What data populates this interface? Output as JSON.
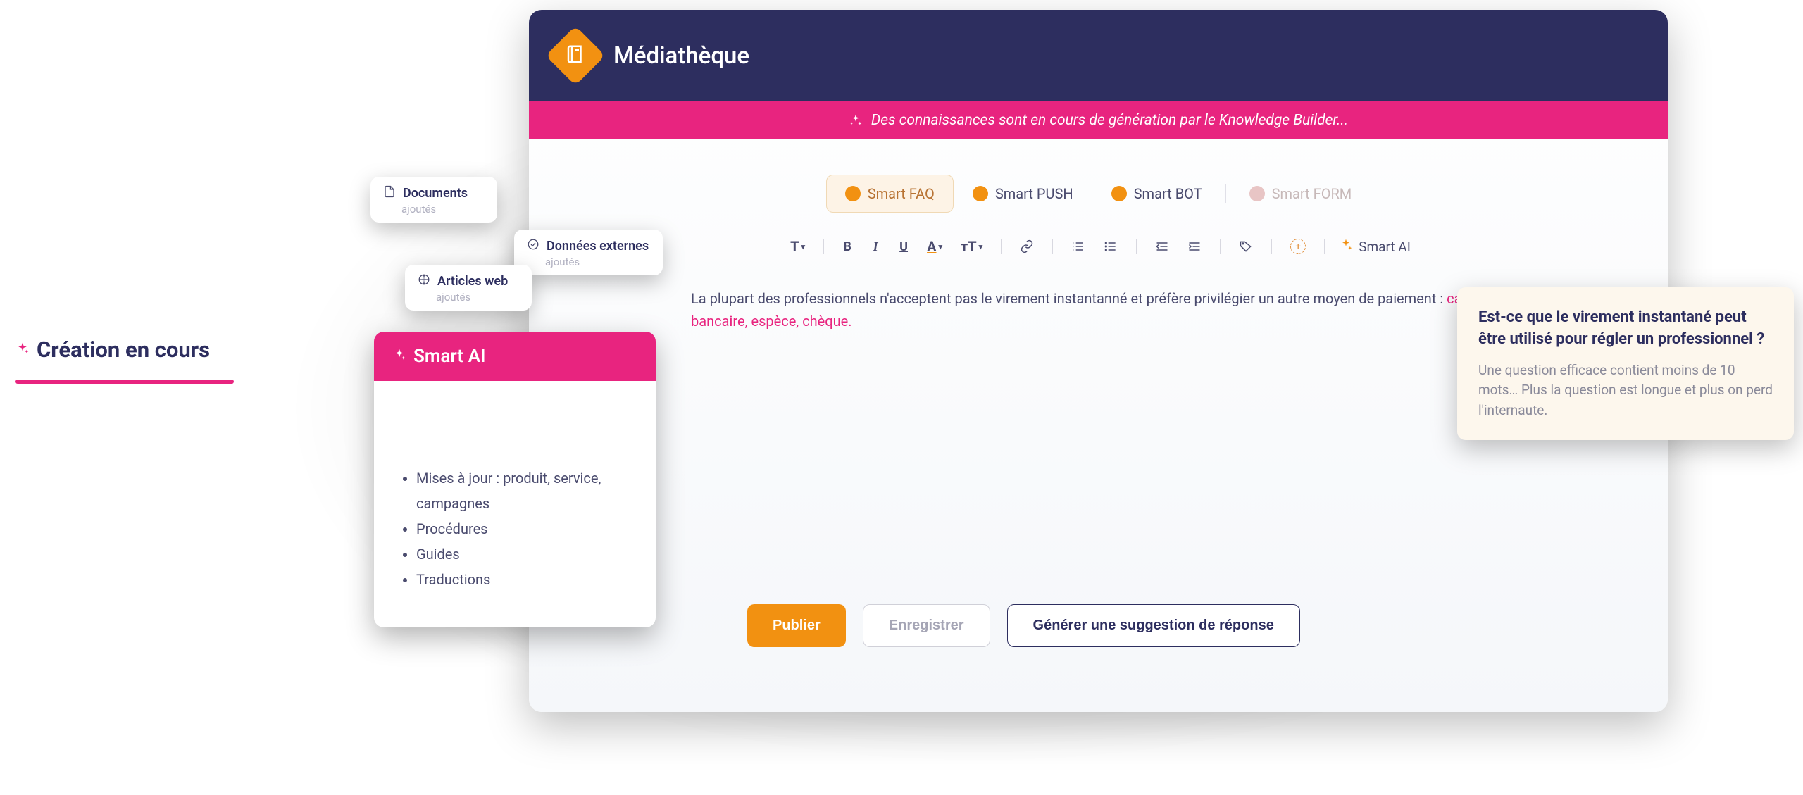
{
  "header": {
    "title": "Médiathèque"
  },
  "alert": {
    "text": "Des connaissances sont en cours de génération par le Knowledge Builder..."
  },
  "tabs": {
    "items": [
      {
        "label": "Smart FAQ",
        "active": true
      },
      {
        "label": "Smart PUSH",
        "active": false
      },
      {
        "label": "Smart BOT",
        "active": false
      },
      {
        "label": "Smart FORM",
        "active": false,
        "disabled": true
      }
    ]
  },
  "toolbar": {
    "smart_ai_label": "Smart AI"
  },
  "editor": {
    "text_before": "La plupart des professionnels n'acceptent pas le virement instantanné et préfère privilégier un autre moyen de paiement : ",
    "highlight": "carte bancaire, espèce, chèque."
  },
  "actions": {
    "publish": "Publier",
    "save": "Enregistrer",
    "generate": "Générer une suggestion de réponse"
  },
  "status": {
    "title": "Création en cours"
  },
  "float_cards": {
    "documents": {
      "title": "Documents",
      "sub": "ajoutés"
    },
    "external": {
      "title": "Données externes",
      "sub": "ajoutés"
    },
    "web": {
      "title": "Articles web",
      "sub": "ajoutés"
    }
  },
  "smartai": {
    "title": "Smart AI",
    "items": [
      "Mises à jour : produit, service, campagnes",
      "Procédures",
      "Guides",
      "Traductions"
    ]
  },
  "tip": {
    "title": "Est-ce que le virement instantané peut être utilisé pour régler un professionnel ?",
    "body": "Une question efficace contient moins de 10 mots… Plus la question est longue et plus on perd l'internaute."
  }
}
